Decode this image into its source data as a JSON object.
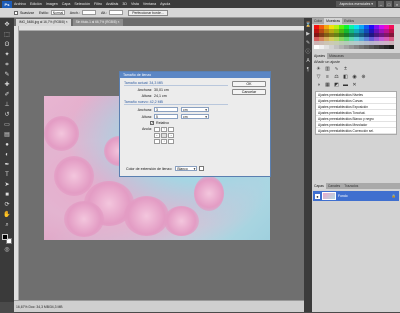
{
  "menubar": {
    "logo": "Ps",
    "items": [
      "Archivo",
      "Edición",
      "Imagen",
      "Capa",
      "Selección",
      "Filtro",
      "Análisis",
      "3D",
      "Vista",
      "Ventana",
      "Ayuda"
    ],
    "workspace": "Aspectos esenciales ▾"
  },
  "options": {
    "antialias_label": "Suavizar",
    "style_label": "Estilo:",
    "style_value": "Normal",
    "width_label": "Anch.:",
    "height_label": "Alt.:",
    "refine_button": "Perfeccionar borde..."
  },
  "tabs": [
    {
      "label": "IMG_5486.jpg al 16,7% (RGB/8) ×"
    },
    {
      "label": "Sin título-1 al 66,7% (RGB/8) ×"
    }
  ],
  "dialog": {
    "title": "Tamaño de lienzo",
    "current_size_label": "Tamaño actual: 34,3 MB",
    "current_width_label": "Anchura:",
    "current_width_value": "30,01 cm",
    "current_height_label": "Altura:",
    "current_height_value": "24,1 cm",
    "new_size_label": "Tamaño nuevo: 42,2 MB",
    "new_width_label": "Anchura:",
    "new_width_value": "3",
    "new_width_unit": "cm",
    "new_height_label": "Altura:",
    "new_height_value": "5",
    "new_height_unit": "cm",
    "relative_label": "Relativo",
    "anchor_label": "Ancla:",
    "extension_color_label": "Color de extensión de lienzo:",
    "extension_color_value": "Blanco",
    "ok_button": "OK",
    "cancel_button": "Cancelar"
  },
  "status": {
    "text": "16,67%   Doc: 34,3 MB/34,3 MB"
  },
  "panels": {
    "swatches_tab": "Muestras",
    "styles_tab": "Estilos",
    "color_tab": "Color",
    "adjustments_tab": "Ajustes",
    "masks_tab": "Máscaras",
    "add_adjustment_title": "Añadir un ajuste",
    "presets": [
      "Ajustes preestablecidos Niveles",
      "Ajustes preestablecidos Curvas",
      "Ajustes preestablecidos Exposición",
      "Ajustes preestablecidos Tono/sat.",
      "Ajustes preestablecidos Blanco y negro",
      "Ajustes preestablecidos Mezclador",
      "Ajustes preestablecidos Corrección sel."
    ],
    "layers_tab": "Capas",
    "channels_tab": "Canales",
    "paths_tab": "Trazados",
    "layer_name": "Fondo"
  },
  "colors": {
    "accent": "#3f6fcf",
    "dialog_title": "#5b86c4"
  }
}
